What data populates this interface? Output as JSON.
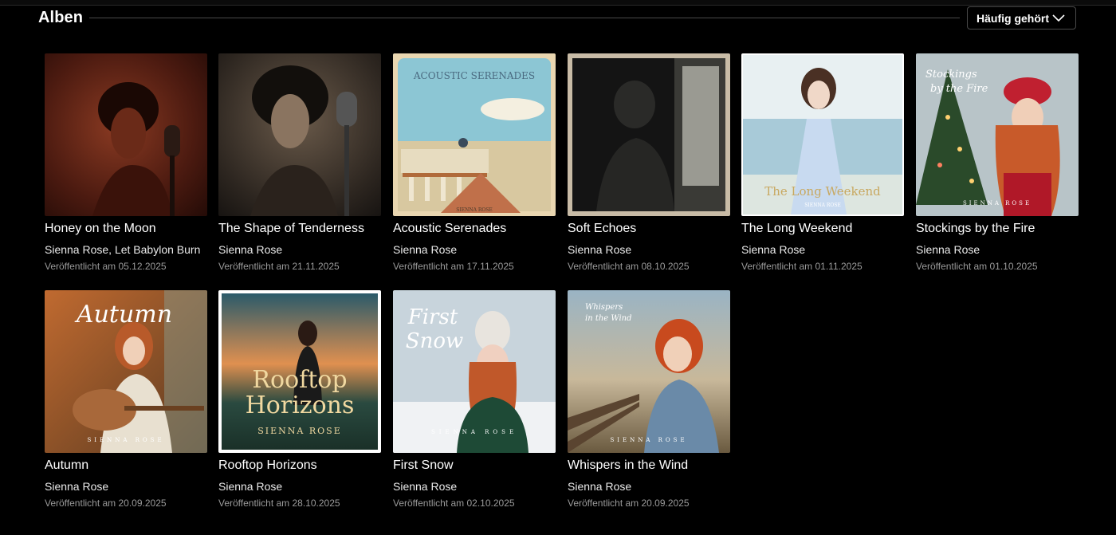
{
  "section": {
    "title": "Alben",
    "sort_label": "Häufig gehört"
  },
  "albums": [
    {
      "title": "Honey on the Moon",
      "artist": "Sienna Rose",
      "artist_extra": "Let Babylon Burn",
      "date": "Veröffentlicht am 05.12.2025"
    },
    {
      "title": "The Shape of Tenderness",
      "artist": "Sienna Rose",
      "date": "Veröffentlicht am 21.11.2025"
    },
    {
      "title": "Acoustic Serenades",
      "artist": "Sienna Rose",
      "date": "Veröffentlicht am 17.11.2025",
      "cover_text": "ACOUSTIC SERENADES",
      "cover_sub": "SIENNA ROSE"
    },
    {
      "title": "Soft Echoes",
      "artist": "Sienna Rose",
      "date": "Veröffentlicht am 08.10.2025"
    },
    {
      "title": "The Long Weekend",
      "artist": "Sienna Rose",
      "date": "Veröffentlicht am 01.11.2025",
      "cover_text": "The Long Weekend",
      "cover_sub": "SIENNA ROSE"
    },
    {
      "title": "Stockings by the Fire",
      "artist": "Sienna Rose",
      "date": "Veröffentlicht am 01.10.2025",
      "cover_text": "Stockings by the Fire",
      "cover_sub": "SIENNA ROSE"
    },
    {
      "title": "Autumn",
      "artist": "Sienna Rose",
      "date": "Veröffentlicht am 20.09.2025",
      "cover_text": "Autumn",
      "cover_sub": "SIENNA ROSE"
    },
    {
      "title": "Rooftop Horizons",
      "artist": "Sienna Rose",
      "date": "Veröffentlicht am 28.10.2025",
      "cover_text": "Rooftop Horizons",
      "cover_sub": "SIENNA ROSE"
    },
    {
      "title": "First Snow",
      "artist": "Sienna Rose",
      "date": "Veröffentlicht am 02.10.2025",
      "cover_text": "First Snow",
      "cover_sub": "SIENNA ROSE"
    },
    {
      "title": "Whispers in the Wind",
      "artist": "Sienna Rose",
      "date": "Veröffentlicht am 20.09.2025",
      "cover_text": "Whispers in the Wind",
      "cover_sub": "SIENNA ROSE"
    }
  ],
  "icons": {
    "sort": "chevron-down-icon"
  }
}
